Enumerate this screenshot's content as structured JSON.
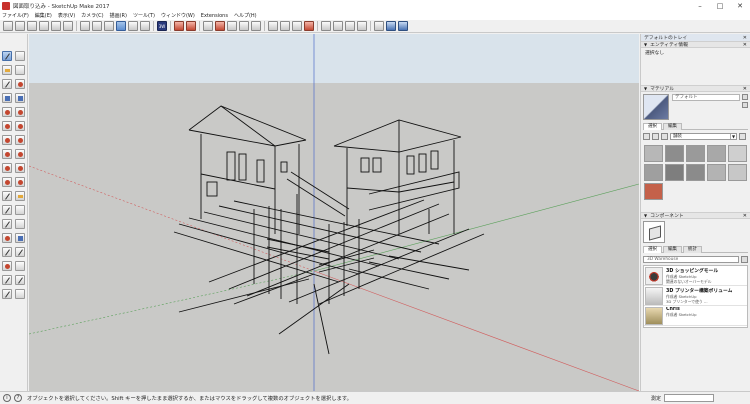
{
  "window": {
    "title": "図面取り込み - SketchUp Make 2017",
    "min_glyph": "–",
    "max_glyph": "□",
    "close_glyph": "✕"
  },
  "menu": [
    "ファイル(F)",
    "編集(E)",
    "表示(V)",
    "カメラ(C)",
    "描画(R)",
    "ツール(T)",
    "ウィンドウ(W)",
    "Extensions",
    "ヘルプ(H)"
  ],
  "toolbar": {
    "warehouse_label": "3W"
  },
  "tray": {
    "title": "デフォルトのトレイ",
    "entity_info": {
      "header": "エンティティ情報",
      "value": "選択なし"
    },
    "materials": {
      "header": "マテリアル",
      "name": "デフォルト",
      "tabs": [
        "選択",
        "編集"
      ],
      "collection": "舗装",
      "swatch_colors": [
        "#b7b7b7",
        "#8d8d8d",
        "#9a9a9a",
        "#a8a8a8",
        "#cfcfcf",
        "#9f9f9f",
        "#7e7e7e",
        "#8b8b8b",
        "#b3b3b3",
        "#c7c7c7",
        "#c4614a"
      ]
    },
    "components": {
      "header": "コンポーネント",
      "tabs": [
        "選択",
        "編集",
        "統計"
      ],
      "search_placeholder": "3D Warehouse",
      "items": [
        {
          "title": "3D ショッピングモール",
          "desc1": "作成者 SketchUp",
          "desc2": "関連のないオーバーモデル"
        },
        {
          "title": "3D プリンター構築ボリューム",
          "desc1": "作成者 SketchUp",
          "desc2": "3D プリンターで使う ..."
        },
        {
          "title": "Chris",
          "desc1": "作成者 SketchUp",
          "desc2": ""
        }
      ]
    }
  },
  "status": {
    "message": "オブジェクトを選択してください。Shift キーを押したまま選択するか、またはマウスをドラッグして複数のオブジェクトを選択します。",
    "measure_label": "測定",
    "info_glyph": "i",
    "help_glyph": "?"
  }
}
